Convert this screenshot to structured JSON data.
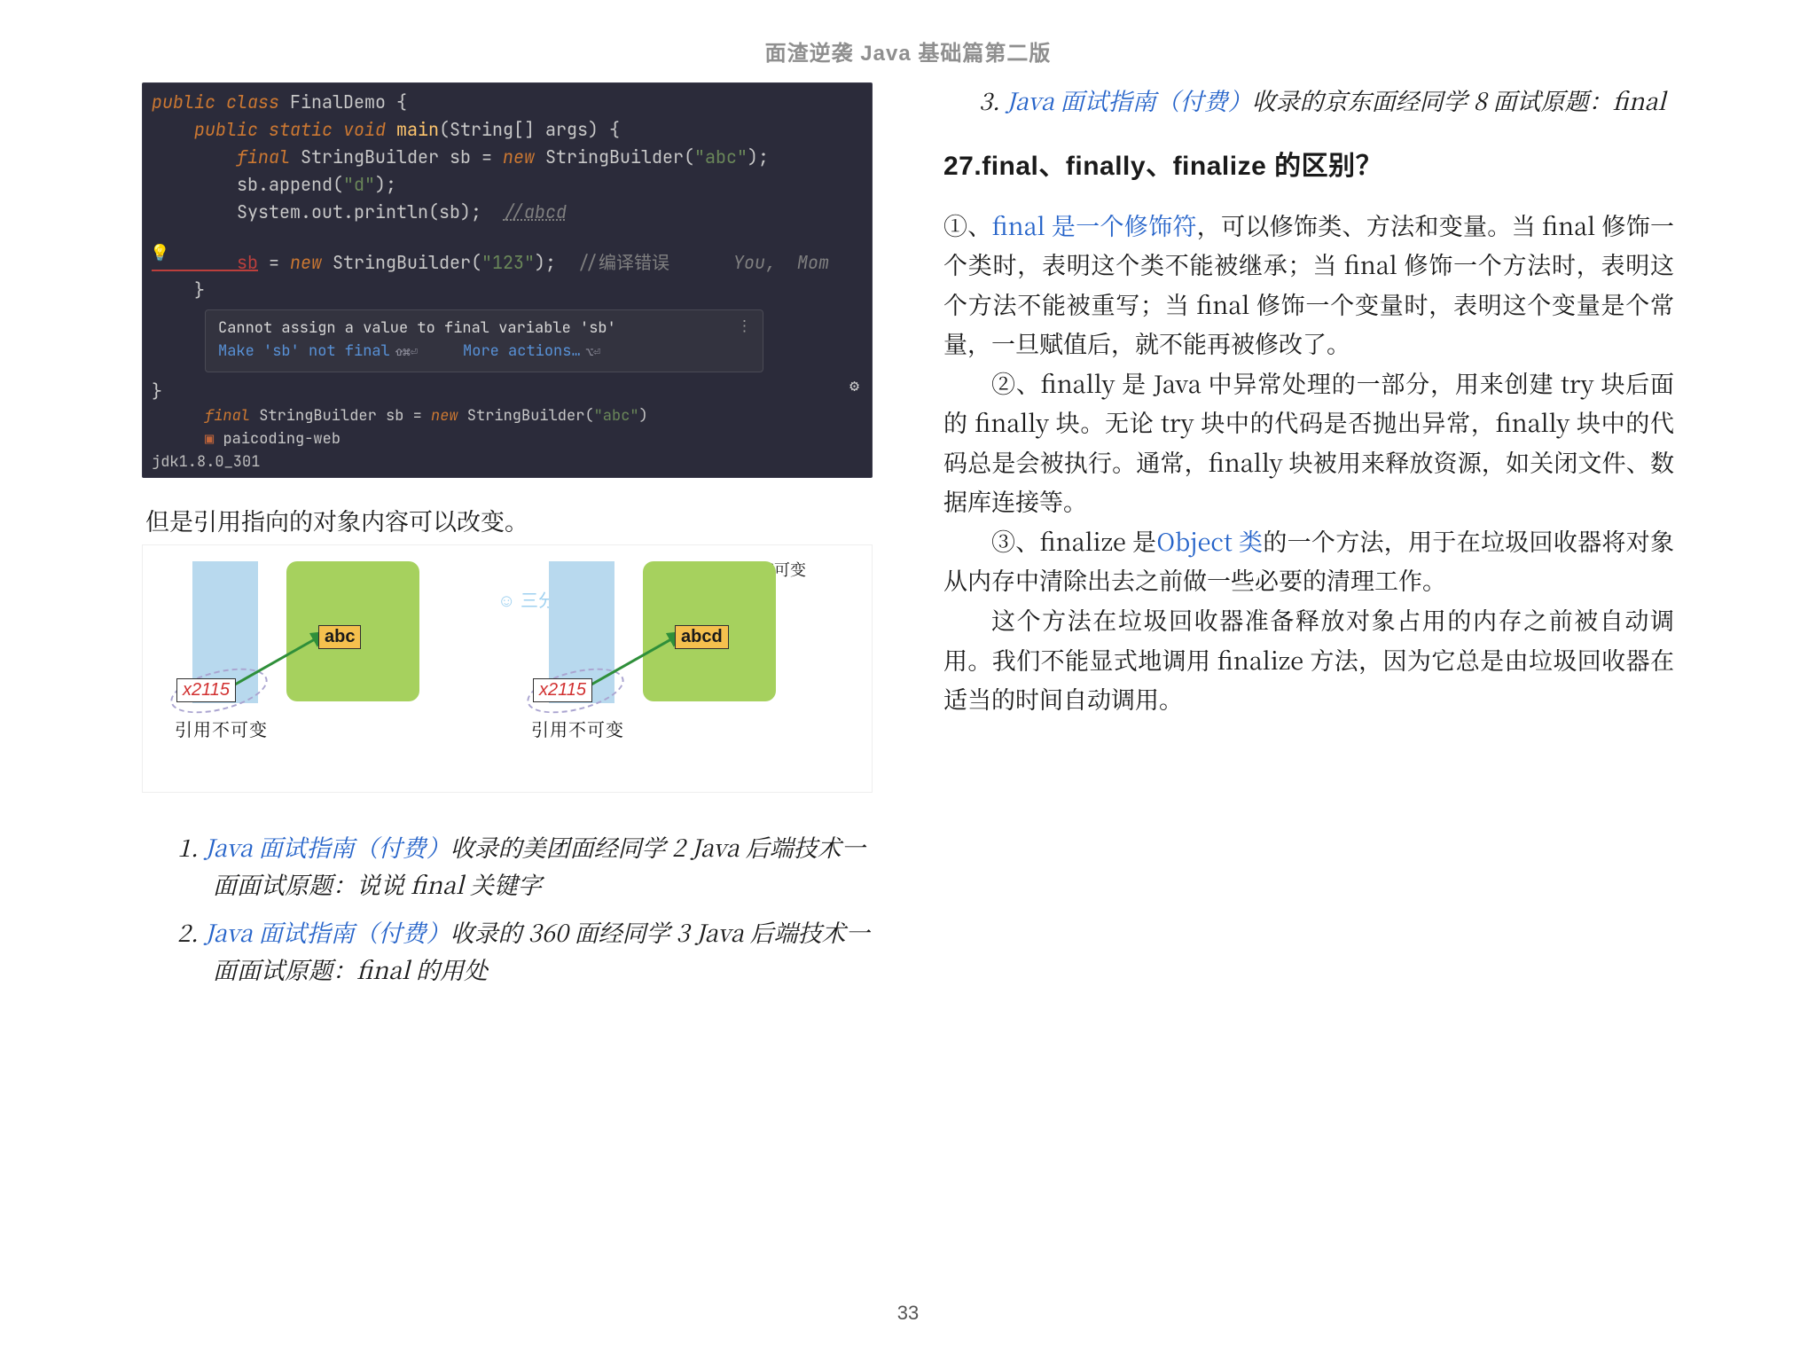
{
  "header": {
    "title": "面渣逆袭 Java 基础篇第二版"
  },
  "code": {
    "l1": "public class FinalDemo {",
    "l2": "    public static void main(String[] args) {",
    "l3a": "        final StringBuilder sb = ",
    "l3b": "new",
    "l3c": " StringBuilder(",
    "l3d": "\"abc\"",
    "l3e": ");",
    "l4a": "        sb.append(",
    "l4b": "\"d\"",
    "l4c": ");",
    "l5a": "        System.out.println(sb);  ",
    "l5b": "//abcd",
    "l6": "",
    "l7a": "        sb",
    "l7b": " = ",
    "l7c": "new",
    "l7d": " StringBuilder(",
    "l7e": "\"123\"",
    "l7f": ");  ",
    "l7g": "//编译错误",
    "l7h": "      You,  Mom",
    "l8": "    }",
    "popup_err": "Cannot assign a value to final variable 'sb'",
    "popup_fix": "Make 'sb' not final",
    "popup_fix_hint": "⇧⌘⏎",
    "popup_more": "More actions…",
    "popup_more_hint": "⌥⏎",
    "l9": "}",
    "proj_line_a": "        final StringBuilder sb = ",
    "proj_line_b": "new",
    "proj_line_c": " StringBuilder(",
    "proj_line_d": "\"abc\"",
    "proj_line_e": ")",
    "proj_name": "paicoding-web",
    "jdk": "jdk1.8.0_301"
  },
  "caption": "但是引用指向的对象内容可以改变。",
  "diagram": {
    "ref_addr": "x2115",
    "val_left": "abc",
    "val_right": "abcd",
    "label_fixed": "引用不可变",
    "label_mutable": "引用指向内容可变",
    "smiley": "☺ 三分恶"
  },
  "list_left": {
    "i1_link": "Java 面试指南（付费）",
    "i1_rest": "收录的美团面经同学 2 Java 后端技术一面面试原题：说说 final 关键字",
    "i2_link": "Java 面试指南（付费）",
    "i2_rest": "收录的 360 面经同学 3 Java 后端技术一面面试原题：final 的用处"
  },
  "list_right": {
    "i3_num": "3. ",
    "i3_link": "Java 面试指南（付费）",
    "i3_rest": "收录的京东面经同学 8 面试原题：final"
  },
  "heading": "27.final、finally、finalize 的区别？",
  "body": {
    "p1a": "①、",
    "p1link": "final 是一个修饰符",
    "p1b": "，可以修饰类、方法和变量。当 final 修饰一个类时，表明这个类不能被继承；当 final 修饰一个方法时，表明这个方法不能被重写；当 final 修饰一个变量时，表明这个变量是个常量，一旦赋值后，就不能再被修改了。",
    "p2": "②、finally 是 Java 中异常处理的一部分，用来创建 try 块后面的 finally 块。无论 try 块中的代码是否抛出异常，finally 块中的代码总是会被执行。通常，finally 块被用来释放资源，如关闭文件、数据库连接等。",
    "p3a": "③、finalize 是",
    "p3link": "Object 类",
    "p3b": "的一个方法，用于在垃圾回收器将对象从内存中清除出去之前做一些必要的清理工作。",
    "p4": "这个方法在垃圾回收器准备释放对象占用的内存之前被自动调用。我们不能显式地调用 finalize 方法，因为它总是由垃圾回收器在适当的时间自动调用。"
  },
  "page_number": "33"
}
